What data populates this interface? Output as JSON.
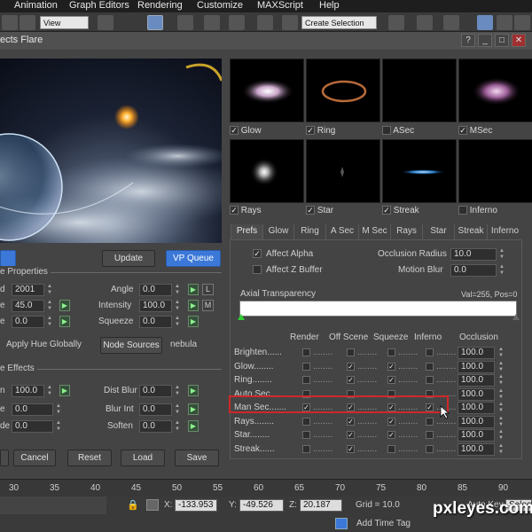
{
  "menu": [
    "Animation",
    "Graph Editors",
    "Rendering",
    "Customize",
    "MAXScript",
    "Help"
  ],
  "toolbar": {
    "view_select": "View",
    "selection_set": "Create Selection Se"
  },
  "window": {
    "title": "ects Flare"
  },
  "preview_buttons": {
    "update": "Update",
    "vp_queue": "VP Queue"
  },
  "lens_properties": {
    "title": "e Properties",
    "seed_label": "d",
    "seed_value": "2001",
    "size_label": "e",
    "size_value": "45.0",
    "hue_label": "e",
    "hue_value": "0.0",
    "angle_label": "Angle",
    "angle_value": "0.0",
    "intensity_label": "Intensity",
    "intensity_value": "100.0",
    "squeeze_label": "Squeeze",
    "squeeze_value": "0.0",
    "apply_hue_label": "Apply Hue Globally",
    "node_sources_label": "Node Sources",
    "node_name": "nebula",
    "lock_l": "L",
    "lock_m": "M"
  },
  "lens_effects": {
    "title": "e Effects",
    "r1_label": "n",
    "r1_value": "100.0",
    "r2_label": "e",
    "r2_value": "0.0",
    "r3_label": "de",
    "r3_value": "0.0",
    "dist_blur_label": "Dist Blur",
    "dist_blur_value": "0.0",
    "blur_int_label": "Blur Int",
    "blur_int_value": "0.0",
    "soften_label": "Soften",
    "soften_value": "0.0"
  },
  "bottom_buttons": {
    "cancel": "Cancel",
    "reset": "Reset",
    "load": "Load",
    "save": "Save"
  },
  "thumbnails": [
    {
      "label": "Glow",
      "checked": true
    },
    {
      "label": "Ring",
      "checked": true
    },
    {
      "label": "ASec",
      "checked": false
    },
    {
      "label": "MSec",
      "checked": true
    },
    {
      "label": "Rays",
      "checked": true
    },
    {
      "label": "Star",
      "checked": true
    },
    {
      "label": "Streak",
      "checked": true
    },
    {
      "label": "Inferno",
      "checked": false
    }
  ],
  "tabs": [
    "Prefs",
    "Glow",
    "Ring",
    "A Sec",
    "M Sec",
    "Rays",
    "Star",
    "Streak",
    "Inferno"
  ],
  "prefs": {
    "affect_alpha": "Affect Alpha",
    "affect_alpha_checked": true,
    "affect_z": "Affect Z Buffer",
    "affect_z_checked": false,
    "occlusion_radius_label": "Occlusion Radius",
    "occlusion_radius_value": "10.0",
    "motion_blur_label": "Motion Blur",
    "motion_blur_value": "0.0",
    "axial_label": "Axial Transparency",
    "axial_readout": "Val=255, Pos=0"
  },
  "table": {
    "headers": [
      "Render",
      "Off Scene",
      "Squeeze",
      "Inferno",
      "Occlusion"
    ],
    "rows": [
      {
        "label": "Brighten......",
        "render": false,
        "off_scene": false,
        "squeeze": false,
        "inferno": false,
        "occlusion": "100.0"
      },
      {
        "label": "Glow........",
        "render": false,
        "off_scene": true,
        "squeeze": true,
        "inferno": false,
        "occlusion": "100.0"
      },
      {
        "label": "Ring........",
        "render": false,
        "off_scene": true,
        "squeeze": true,
        "inferno": false,
        "occlusion": "100.0"
      },
      {
        "label": "Auto Sec.....",
        "render": false,
        "off_scene": false,
        "squeeze": false,
        "inferno": false,
        "occlusion": "100.0"
      },
      {
        "label": "Man Sec.......",
        "render": true,
        "off_scene": true,
        "squeeze": true,
        "inferno": true,
        "occlusion": "100.0"
      },
      {
        "label": "Rays........",
        "render": false,
        "off_scene": true,
        "squeeze": true,
        "inferno": false,
        "occlusion": "100.0"
      },
      {
        "label": "Star........",
        "render": false,
        "off_scene": true,
        "squeeze": true,
        "inferno": false,
        "occlusion": "100.0"
      },
      {
        "label": "Streak......",
        "render": false,
        "off_scene": true,
        "squeeze": false,
        "inferno": false,
        "occlusion": "100.0"
      }
    ]
  },
  "timeline": {
    "ticks": [
      "30",
      "35",
      "40",
      "45",
      "50",
      "55",
      "60",
      "65",
      "70",
      "75",
      "80",
      "85",
      "90"
    ]
  },
  "status": {
    "x_label": "X:",
    "x_value": "-133.953",
    "y_label": "Y:",
    "y_value": "-49.526",
    "z_label": "Z:",
    "z_value": "20.187",
    "grid": "Grid = 10.0",
    "auto_key": "Auto Key",
    "selected": "Selecte",
    "add_time_tag": "Add Time Tag"
  },
  "watermark": "pxleyes.com",
  "colors": {
    "accent_blue": "#3b78d8",
    "highlight_red": "#d02828",
    "green_button": "#8bf08b"
  }
}
